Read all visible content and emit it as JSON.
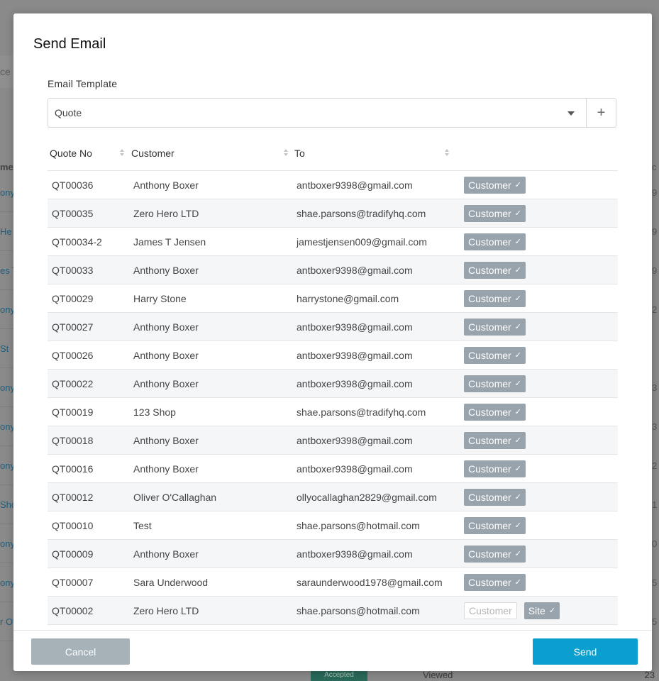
{
  "background": {
    "strip_text": "ce",
    "left_column_header": "me",
    "left_column": [
      "ony",
      "He",
      "es T",
      "ony",
      " St",
      "ony",
      "ony",
      "ony",
      "Sho",
      "ony",
      "ony",
      "r O'"
    ],
    "right_column_header": "c",
    "right_column": [
      "9",
      "9",
      "9",
      "2",
      "",
      "3",
      "3",
      "2",
      "1",
      "0",
      "5",
      "5"
    ],
    "bottom_badge": "Accepted",
    "bottom_status": "Viewed",
    "bottom_number": "23"
  },
  "modal": {
    "title": "Send Email",
    "template_label": "Email Template",
    "template_value": "Quote",
    "add_icon": "+",
    "table": {
      "headers": {
        "quote_no": "Quote No",
        "customer": "Customer",
        "to": "To"
      },
      "rows": [
        {
          "quote_no": "QT00036",
          "customer": "Anthony Boxer",
          "to": "antboxer9398@gmail.com",
          "tags": [
            {
              "label": "Customer",
              "selected": true
            }
          ]
        },
        {
          "quote_no": "QT00035",
          "customer": "Zero Hero LTD",
          "to": "shae.parsons@tradifyhq.com",
          "tags": [
            {
              "label": "Customer",
              "selected": true
            }
          ]
        },
        {
          "quote_no": "QT00034-2",
          "customer": "James T Jensen",
          "to": "jamestjensen009@gmail.com",
          "tags": [
            {
              "label": "Customer",
              "selected": true
            }
          ]
        },
        {
          "quote_no": "QT00033",
          "customer": "Anthony Boxer",
          "to": "antboxer9398@gmail.com",
          "tags": [
            {
              "label": "Customer",
              "selected": true
            }
          ]
        },
        {
          "quote_no": "QT00029",
          "customer": "Harry Stone",
          "to": "harrystone@gmail.com",
          "tags": [
            {
              "label": "Customer",
              "selected": true
            }
          ]
        },
        {
          "quote_no": "QT00027",
          "customer": "Anthony Boxer",
          "to": "antboxer9398@gmail.com",
          "tags": [
            {
              "label": "Customer",
              "selected": true
            }
          ]
        },
        {
          "quote_no": "QT00026",
          "customer": "Anthony Boxer",
          "to": "antboxer9398@gmail.com",
          "tags": [
            {
              "label": "Customer",
              "selected": true
            }
          ]
        },
        {
          "quote_no": "QT00022",
          "customer": "Anthony Boxer",
          "to": "antboxer9398@gmail.com",
          "tags": [
            {
              "label": "Customer",
              "selected": true
            }
          ]
        },
        {
          "quote_no": "QT00019",
          "customer": "123 Shop",
          "to": "shae.parsons@tradifyhq.com",
          "tags": [
            {
              "label": "Customer",
              "selected": true
            }
          ]
        },
        {
          "quote_no": "QT00018",
          "customer": "Anthony Boxer",
          "to": "antboxer9398@gmail.com",
          "tags": [
            {
              "label": "Customer",
              "selected": true
            }
          ]
        },
        {
          "quote_no": "QT00016",
          "customer": "Anthony Boxer",
          "to": "antboxer9398@gmail.com",
          "tags": [
            {
              "label": "Customer",
              "selected": true
            }
          ]
        },
        {
          "quote_no": "QT00012",
          "customer": "Oliver O'Callaghan",
          "to": "ollyocallaghan2829@gmail.com",
          "tags": [
            {
              "label": "Customer",
              "selected": true
            }
          ]
        },
        {
          "quote_no": "QT00010",
          "customer": "Test",
          "to": "shae.parsons@hotmail.com",
          "tags": [
            {
              "label": "Customer",
              "selected": true
            }
          ]
        },
        {
          "quote_no": "QT00009",
          "customer": "Anthony Boxer",
          "to": "antboxer9398@gmail.com",
          "tags": [
            {
              "label": "Customer",
              "selected": true
            }
          ]
        },
        {
          "quote_no": "QT00007",
          "customer": "Sara Underwood",
          "to": "saraunderwood1978@gmail.com",
          "tags": [
            {
              "label": "Customer",
              "selected": true
            }
          ]
        },
        {
          "quote_no": "QT00002",
          "customer": "Zero Hero LTD",
          "to": "shae.parsons@hotmail.com",
          "tags": [
            {
              "label": "Customer",
              "selected": false
            },
            {
              "label": "Site",
              "selected": true
            }
          ]
        }
      ]
    },
    "check_icon": "✓",
    "cancel_label": "Cancel",
    "send_label": "Send"
  },
  "colors": {
    "send_button": "#0b9fd0",
    "cancel_button": "#a6b1b8",
    "tag_selected": "#99a3ab"
  }
}
